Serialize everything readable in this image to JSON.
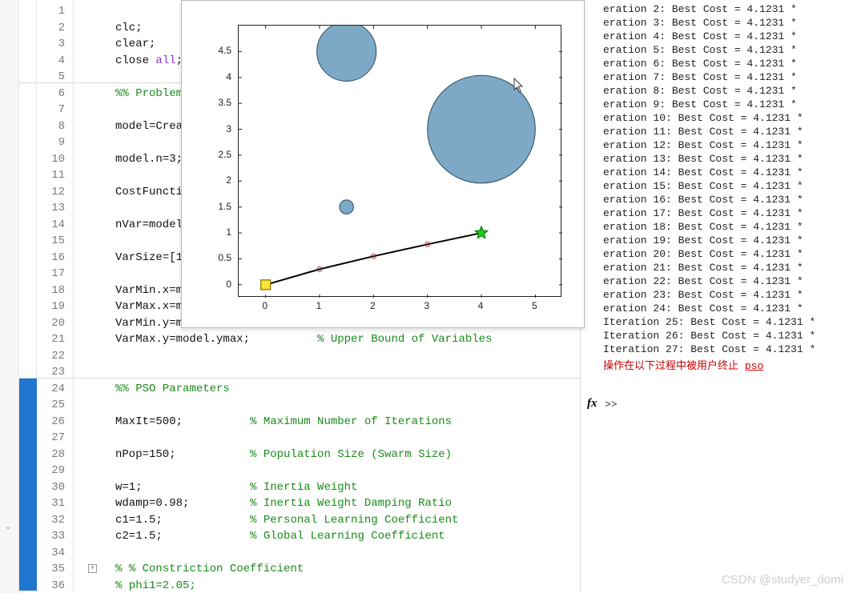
{
  "editor": {
    "lines": [
      {
        "n": 1,
        "segments": []
      },
      {
        "n": 2,
        "segments": [
          {
            "t": "clc;",
            "c": "plain"
          }
        ]
      },
      {
        "n": 3,
        "segments": [
          {
            "t": "clear;",
            "c": "plain"
          }
        ]
      },
      {
        "n": 4,
        "segments": [
          {
            "t": "close ",
            "c": "plain"
          },
          {
            "t": "all",
            "c": "k-str"
          },
          {
            "t": ";",
            "c": "plain"
          }
        ]
      },
      {
        "n": 5,
        "segments": []
      },
      {
        "n": 6,
        "segments": [
          {
            "t": "%% Problem",
            "c": "k-cm"
          }
        ],
        "hr": true
      },
      {
        "n": 7,
        "segments": []
      },
      {
        "n": 8,
        "segments": [
          {
            "t": "model=Crea",
            "c": "plain"
          }
        ]
      },
      {
        "n": 9,
        "segments": []
      },
      {
        "n": 10,
        "segments": [
          {
            "t": "model.n=3;",
            "c": "plain"
          }
        ]
      },
      {
        "n": 11,
        "segments": []
      },
      {
        "n": 12,
        "segments": [
          {
            "t": "CostFuncti",
            "c": "plain"
          }
        ]
      },
      {
        "n": 13,
        "segments": []
      },
      {
        "n": 14,
        "segments": [
          {
            "t": "nVar=model",
            "c": "plain"
          }
        ]
      },
      {
        "n": 15,
        "segments": []
      },
      {
        "n": 16,
        "segments": [
          {
            "t": "VarSize=[1",
            "c": "plain"
          }
        ]
      },
      {
        "n": 17,
        "segments": []
      },
      {
        "n": 18,
        "segments": [
          {
            "t": "VarMin.x=m",
            "c": "plain"
          }
        ]
      },
      {
        "n": 19,
        "segments": [
          {
            "t": "VarMax.x=m",
            "c": "plain"
          }
        ]
      },
      {
        "n": 20,
        "segments": [
          {
            "t": "VarMin.y=model.ymin;          ",
            "c": "plain"
          },
          {
            "t": "% Lower Bound of Variables",
            "c": "k-cm"
          }
        ]
      },
      {
        "n": 21,
        "segments": [
          {
            "t": "VarMax.y=model.ymax;          ",
            "c": "plain"
          },
          {
            "t": "% Upper Bound of Variables",
            "c": "k-cm"
          }
        ]
      },
      {
        "n": 22,
        "segments": []
      },
      {
        "n": 23,
        "segments": []
      },
      {
        "n": 24,
        "segments": [
          {
            "t": "%% PSO Parameters",
            "c": "k-cm"
          }
        ],
        "hr": true,
        "blue": true
      },
      {
        "n": 25,
        "segments": [],
        "blue": true
      },
      {
        "n": 26,
        "segments": [
          {
            "t": "MaxIt=500;          ",
            "c": "plain"
          },
          {
            "t": "% Maximum Number of Iterations",
            "c": "k-cm"
          }
        ],
        "blue": true
      },
      {
        "n": 27,
        "segments": [],
        "blue": true
      },
      {
        "n": 28,
        "segments": [
          {
            "t": "nPop=150;           ",
            "c": "plain"
          },
          {
            "t": "% Population Size (Swarm Size)",
            "c": "k-cm"
          }
        ],
        "blue": true
      },
      {
        "n": 29,
        "segments": [],
        "blue": true
      },
      {
        "n": 30,
        "segments": [
          {
            "t": "w=1;                ",
            "c": "plain"
          },
          {
            "t": "% Inertia Weight",
            "c": "k-cm"
          }
        ],
        "blue": true
      },
      {
        "n": 31,
        "segments": [
          {
            "t": "wdamp=0.98;         ",
            "c": "plain"
          },
          {
            "t": "% Inertia Weight Damping Ratio",
            "c": "k-cm"
          }
        ],
        "blue": true
      },
      {
        "n": 32,
        "segments": [
          {
            "t": "c1=1.5;             ",
            "c": "plain"
          },
          {
            "t": "% Personal Learning Coefficient",
            "c": "k-cm"
          }
        ],
        "blue": true
      },
      {
        "n": 33,
        "segments": [
          {
            "t": "c2=1.5;             ",
            "c": "plain"
          },
          {
            "t": "% Global Learning Coefficient",
            "c": "k-cm"
          }
        ],
        "blue": true
      },
      {
        "n": 34,
        "segments": [],
        "blue": true
      },
      {
        "n": 35,
        "segments": [
          {
            "t": "% % Constriction Coefficient",
            "c": "k-cm"
          }
        ],
        "fold": true,
        "blue": true
      },
      {
        "n": 36,
        "segments": [
          {
            "t": "% phi1=2.05;",
            "c": "k-cm"
          }
        ],
        "blue": true
      }
    ],
    "line_height": 20.5,
    "top_offset": 0
  },
  "console": {
    "iterations": [
      {
        "label": "eration 2: Best Cost = 4.1231 *"
      },
      {
        "label": "eration 3: Best Cost = 4.1231 *"
      },
      {
        "label": "eration 4: Best Cost = 4.1231 *"
      },
      {
        "label": "eration 5: Best Cost = 4.1231 *"
      },
      {
        "label": "eration 6: Best Cost = 4.1231 *"
      },
      {
        "label": "eration 7: Best Cost = 4.1231 *"
      },
      {
        "label": "eration 8: Best Cost = 4.1231 *"
      },
      {
        "label": "eration 9: Best Cost = 4.1231 *"
      },
      {
        "label": "eration 10: Best Cost = 4.1231 *"
      },
      {
        "label": "eration 11: Best Cost = 4.1231 *"
      },
      {
        "label": "eration 12: Best Cost = 4.1231 *"
      },
      {
        "label": "eration 13: Best Cost = 4.1231 *"
      },
      {
        "label": "eration 14: Best Cost = 4.1231 *"
      },
      {
        "label": "eration 15: Best Cost = 4.1231 *"
      },
      {
        "label": "eration 16: Best Cost = 4.1231 *"
      },
      {
        "label": "eration 17: Best Cost = 4.1231 *"
      },
      {
        "label": "eration 18: Best Cost = 4.1231 *"
      },
      {
        "label": "eration 19: Best Cost = 4.1231 *"
      },
      {
        "label": "eration 20: Best Cost = 4.1231 *"
      },
      {
        "label": "eration 21: Best Cost = 4.1231 *"
      },
      {
        "label": "eration 22: Best Cost = 4.1231 *"
      },
      {
        "label": "eration 23: Best Cost = 4.1231 *"
      },
      {
        "label": "eration 24: Best Cost = 4.1231 *"
      },
      {
        "label": "Iteration 25: Best Cost = 4.1231 *"
      },
      {
        "label": "Iteration 26: Best Cost = 4.1231 *"
      },
      {
        "label": "Iteration 27: Best Cost = 4.1231 *"
      }
    ],
    "error_prefix": "操作在以下过程中被用户终止 ",
    "error_link": "pso",
    "prompt": ">>",
    "fx": "fx"
  },
  "chart_data": {
    "type": "scatter-path",
    "xlim": [
      -0.5,
      5.5
    ],
    "ylim": [
      -0.25,
      5.0
    ],
    "xticks": [
      0,
      1,
      2,
      3,
      4,
      5
    ],
    "yticks": [
      0,
      0.5,
      1,
      1.5,
      2,
      2.5,
      3,
      3.5,
      4,
      4.5
    ],
    "circles": [
      {
        "cx": 1.5,
        "cy": 4.5,
        "r": 0.55,
        "fill": "#7ea9c6"
      },
      {
        "cx": 1.5,
        "cy": 1.5,
        "r": 0.13,
        "fill": "#7ea9c6"
      },
      {
        "cx": 4.0,
        "cy": 3.0,
        "r": 1.0,
        "fill": "#7ea9c6"
      }
    ],
    "path": {
      "pts": [
        [
          0,
          0
        ],
        [
          1,
          0.3
        ],
        [
          2,
          0.55
        ],
        [
          3,
          0.78
        ],
        [
          4,
          1.0
        ]
      ],
      "marker": "o",
      "color": "#000"
    },
    "start": {
      "x": 0,
      "y": 0,
      "shape": "square",
      "fill": "#ffe438",
      "stroke": "#8c7a00"
    },
    "goal": {
      "x": 4,
      "y": 1,
      "shape": "star",
      "fill": "#18d118",
      "stroke": "#0a7a0a"
    }
  },
  "watermark": "CSDN @studyer_domi",
  "left_panel_dropdown_glyph": "⌄"
}
